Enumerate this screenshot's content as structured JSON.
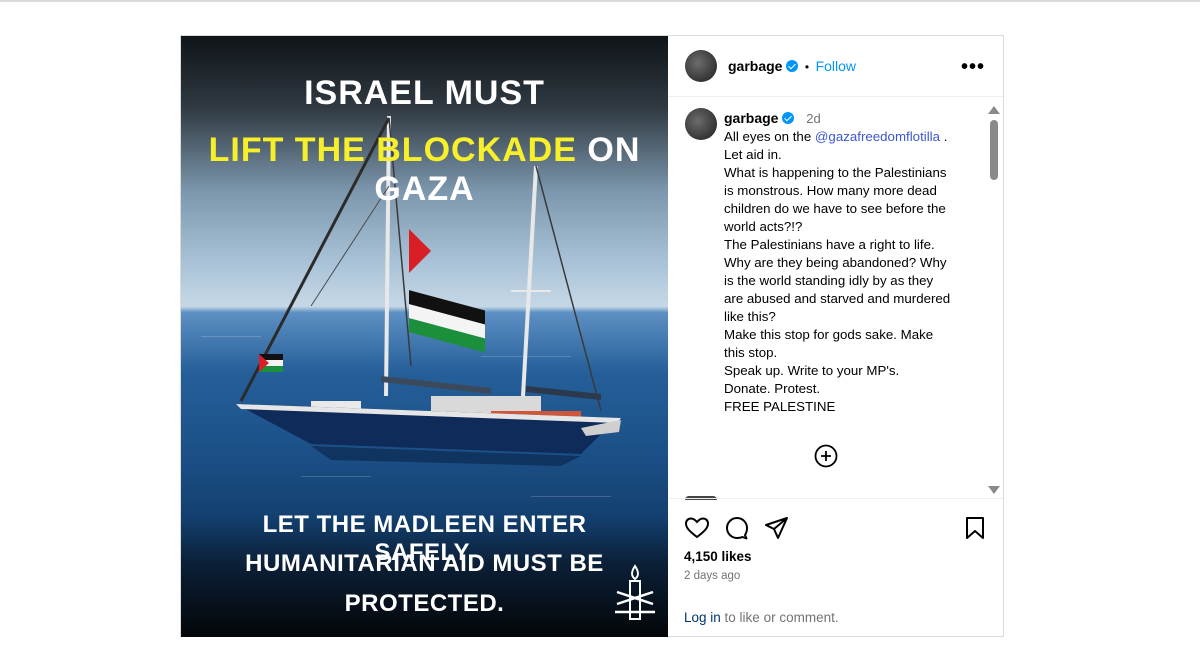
{
  "post": {
    "image": {
      "headline_line1": "ISRAEL MUST",
      "headline_line2_highlight": "LIFT THE BLOCKADE",
      "headline_line2_rest": "ON GAZA",
      "footer_line1": "LET THE MADLEEN ENTER SAFELY.",
      "footer_line2": "HUMANITARIAN AID MUST BE",
      "footer_line3": "PROTECTED.",
      "logo_icon": "amnesty-candle-icon",
      "highlight_color": "#f7ef2a"
    },
    "header": {
      "username": "garbage",
      "follow_label": "Follow",
      "separator": "•",
      "more_icon": "more-horizontal-icon"
    },
    "caption": {
      "username": "garbage",
      "time": "2d",
      "lines": [
        "All eyes on the ",
        "Let aid in.",
        "What is happening to the Palestinians",
        "is monstrous. How many more dead",
        "children do we have to see before the",
        "world acts?!?",
        "The Palestinians have a right to life.",
        "Why are they being abandoned? Why",
        "is the world standing idly by as they",
        "are abused and starved and murdered",
        "like this?",
        "Make this stop for gods sake. Make",
        "this stop.",
        "Speak up. Write to your MP's.",
        "Donate. Protest.",
        "FREE PALESTINE"
      ],
      "mention": "@gazafreedomflotilla",
      "mention_suffix": " ."
    },
    "actions": {
      "like_icon": "heart-icon",
      "comment_icon": "comment-icon",
      "share_icon": "share-icon",
      "save_icon": "bookmark-icon",
      "load_more_icon": "plus-circle-icon"
    },
    "likes": "4,150 likes",
    "posted_ago": "2 days ago",
    "login_link": "Log in",
    "login_text": " to like or comment.",
    "accent_color": "#0095f6"
  }
}
